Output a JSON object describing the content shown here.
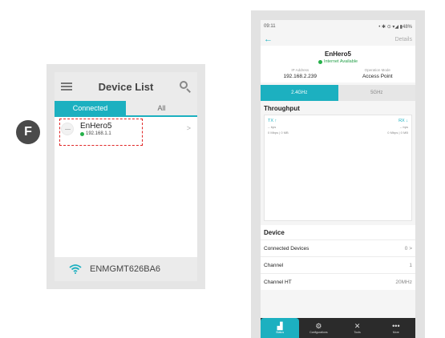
{
  "badge": {
    "letter": "F"
  },
  "device_list": {
    "title": "Device List",
    "tabs": [
      "Connected",
      "All"
    ],
    "device": {
      "name": "EnHero5",
      "ip": "192.168.1.1"
    },
    "chevron": ">",
    "footer": {
      "ssid": "ENMGMT626BA6"
    }
  },
  "status_screen": {
    "status_bar": {
      "time": "09:11",
      "icons": "• ✱ ⊙ ▾◢ ▮48%"
    },
    "nav": {
      "back": "←",
      "details": "Details"
    },
    "device_name": "EnHero5",
    "internet_status": "Internet Available",
    "ip_label": "IP Address",
    "ip_value": "192.168.2.239",
    "mode_label": "Operation Mode",
    "mode_value": "Access Point",
    "bands": [
      "2.4GHz",
      "5GHz"
    ],
    "throughput": {
      "title": "Throughput",
      "tx_label": "TX ↑",
      "rx_label": "RX ↓",
      "tx_rate": "-- bps",
      "rx_rate": "-- bps",
      "tx_detail": "0 Mbps  |  0 MB",
      "rx_detail": "0 Mbps  |  0 MB"
    },
    "device_section": {
      "title": "Device",
      "rows": [
        {
          "label": "Connected Devices",
          "value": "0 >"
        },
        {
          "label": "Channel",
          "value": "1"
        },
        {
          "label": "Channel HT",
          "value": "20MHz"
        }
      ]
    },
    "bottom_nav": [
      {
        "label": "Status",
        "icon": "▟"
      },
      {
        "label": "Configurations",
        "icon": "⚙"
      },
      {
        "label": "Tools",
        "icon": "✕"
      },
      {
        "label": "More",
        "icon": "•••"
      }
    ]
  },
  "colors": {
    "accent": "#1cb0c0",
    "online": "#26b04a",
    "highlight": "#e02525",
    "nav_dark": "#2b2b2b"
  }
}
